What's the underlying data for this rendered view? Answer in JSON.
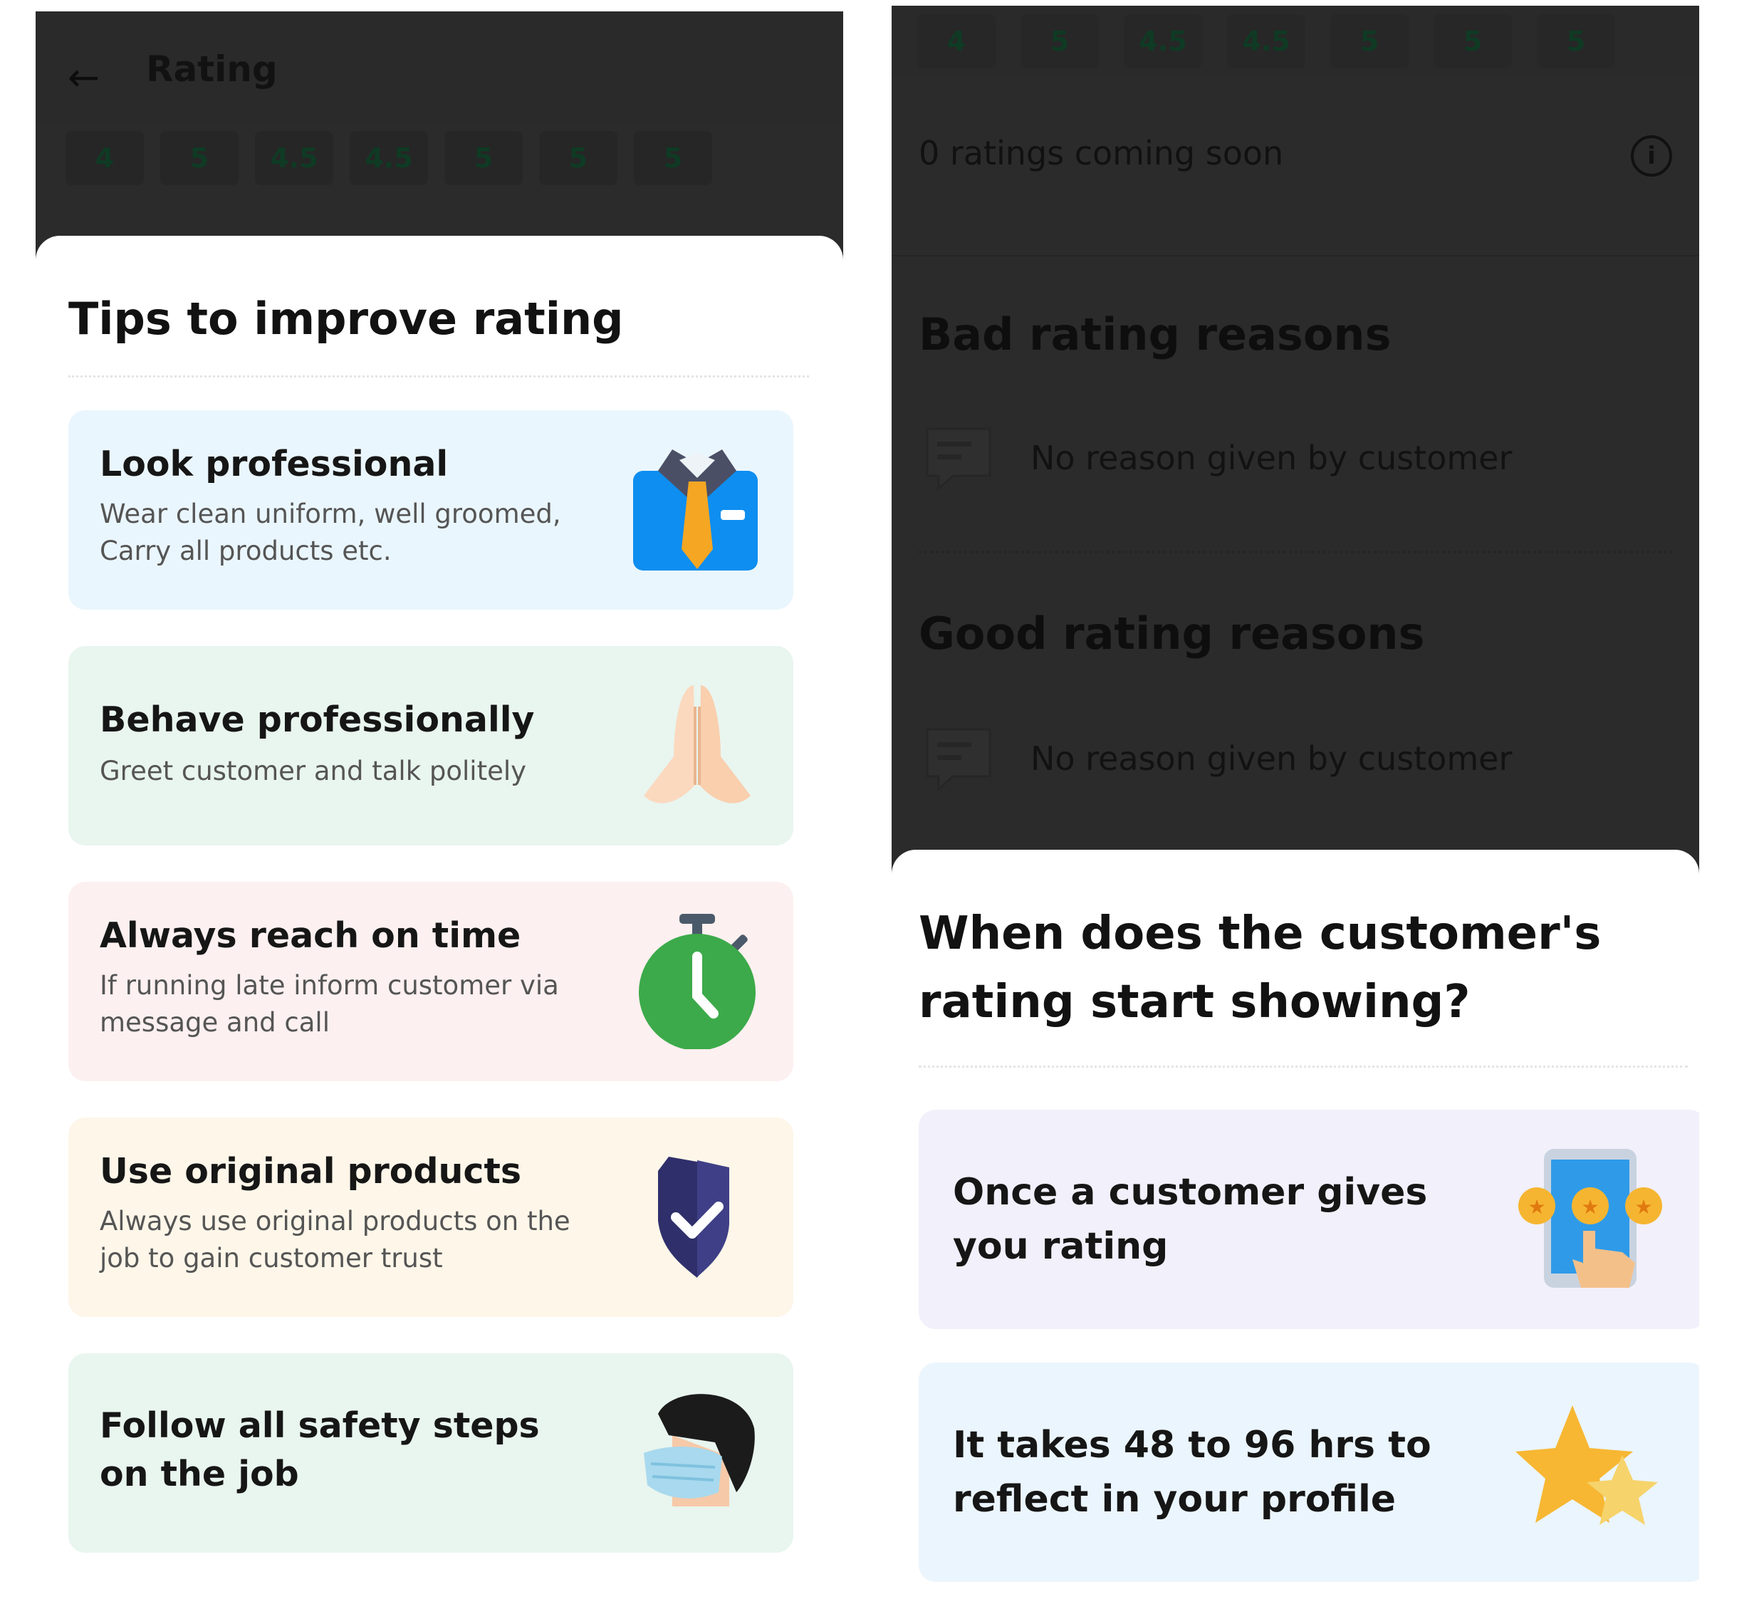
{
  "left_screen": {
    "header": {
      "title": "Rating"
    },
    "ratings": [
      "4",
      "5",
      "4.5",
      "4.5",
      "5",
      "5",
      "5"
    ],
    "sheet": {
      "title": "Tips to improve rating",
      "tips": [
        {
          "title": "Look professional",
          "description": "Wear clean uniform, well groomed, Carry all products etc.",
          "icon": "uniform-icon",
          "bg": "#eaf6fd"
        },
        {
          "title": "Behave professionally",
          "description": "Greet customer and talk politely",
          "icon": "namaste-hands-icon",
          "bg": "#e9f5ef"
        },
        {
          "title": "Always reach on time",
          "description": "If running late inform customer via message and call",
          "icon": "stopwatch-icon",
          "bg": "#fdf0f0"
        },
        {
          "title": "Use original products",
          "description": "Always use original products on the job to gain customer trust",
          "icon": "shield-check-icon",
          "bg": "#fdf6e9"
        },
        {
          "title": "Follow all safety steps on the job",
          "description": "",
          "icon": "face-mask-icon",
          "bg": "#e9f5ef"
        }
      ]
    }
  },
  "right_screen": {
    "ratings": [
      "4",
      "5",
      "4.5",
      "4.5",
      "5",
      "5",
      "5"
    ],
    "coming_soon": "0 ratings coming soon",
    "bad_title": "Bad rating reasons",
    "bad_reason": "No reason given by customer",
    "good_title": "Good rating reasons",
    "good_reason": "No reason given by customer",
    "sheet": {
      "title": "When does the customer's rating start showing?",
      "cards": [
        {
          "title": "Once a customer gives you rating",
          "icon": "phone-stars-icon",
          "bg": "#f1f0fb"
        },
        {
          "title": "It takes 48 to 96 hrs to reflect in your profile",
          "icon": "stars-icon",
          "bg": "#ebf5fd"
        }
      ]
    }
  }
}
